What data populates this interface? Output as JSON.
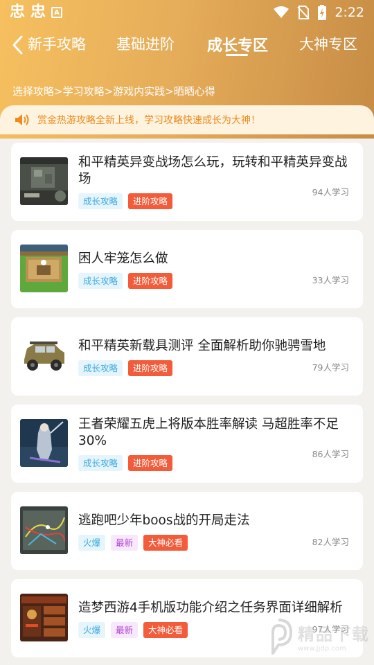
{
  "status_bar": {
    "app_icons": [
      "忠",
      "忠"
    ],
    "time": "2:22"
  },
  "nav": {
    "tabs": [
      {
        "label": "新手攻略"
      },
      {
        "label": "基础进阶"
      },
      {
        "label": "成长专区"
      },
      {
        "label": "大神专区"
      }
    ],
    "active_tab": "成长专区"
  },
  "breadcrumb": "选择攻略>学习攻略>游戏内实践>晒晒心得",
  "notice": {
    "text": "赏金热游攻略全新上线，学习攻略快速成长为大神！"
  },
  "articles": [
    {
      "title": "和平精英异变战场怎么玩，玩转和平精英异变战场",
      "tags": [
        {
          "label": "成长攻略",
          "style": "blue"
        },
        {
          "label": "进阶攻略",
          "style": "red"
        }
      ],
      "count": "94人学习",
      "thumb": "game-map-scene"
    },
    {
      "title": "困人牢笼怎么做",
      "tags": [
        {
          "label": "成长攻略",
          "style": "blue"
        },
        {
          "label": "进阶攻略",
          "style": "red"
        }
      ],
      "count": "33人学习",
      "thumb": "cage-building"
    },
    {
      "title": "和平精英新载具测评 全面解析助你驰骋雪地",
      "tags": [
        {
          "label": "成长攻略",
          "style": "blue"
        },
        {
          "label": "进阶攻略",
          "style": "red"
        }
      ],
      "count": "79人学习",
      "thumb": "vehicle"
    },
    {
      "title": "王者荣耀五虎上将版本胜率解读 马超胜率不足30%",
      "tags": [
        {
          "label": "成长攻略",
          "style": "blue"
        },
        {
          "label": "进阶攻略",
          "style": "red"
        }
      ],
      "count": "86人学习",
      "thumb": "hero-character"
    },
    {
      "title": "逃跑吧少年boos战的开局走法",
      "tags": [
        {
          "label": "火爆",
          "style": "blue"
        },
        {
          "label": "最新",
          "style": "purple"
        },
        {
          "label": "大神必看",
          "style": "red"
        }
      ],
      "count": "82人学习",
      "thumb": "map-route"
    },
    {
      "title": "造梦西游4手机版功能介绍之任务界面详细解析",
      "tags": [
        {
          "label": "火爆",
          "style": "blue"
        },
        {
          "label": "最新",
          "style": "purple"
        },
        {
          "label": "大神必看",
          "style": "red"
        }
      ],
      "count": "97人学习",
      "thumb": "task-interface"
    }
  ],
  "watermark": {
    "text": "精品下载",
    "url": "www.jjdp.com"
  },
  "colors": {
    "header_start": "#f6c05f",
    "header_end": "#c78c45",
    "notice_text": "#ef8a1f",
    "tag_blue": "#3aa8e2",
    "tag_red": "#f25c3a",
    "tag_purple": "#b44ad6"
  }
}
